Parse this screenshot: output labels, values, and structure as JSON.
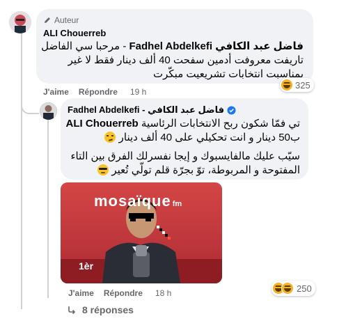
{
  "comment1": {
    "badge": "Auteur",
    "author": "ALI Chouerreb",
    "lines": [
      "فاضل عبد الكافي Fadhel Abdelkefi - مرحبا سي الفاضل",
      "تاريفت معروفت أدمين سفحت 40 ألف دينار فقط لا غير",
      "بمناسبت انتخابات تشريعيت مبكّرت"
    ],
    "mention": "فاضل عبد الكافي Fadhel Abdelkefi",
    "actions": {
      "like": "J'aime",
      "reply": "Répondre",
      "time": "19 h"
    },
    "reactions": {
      "count": "325",
      "type": "haha"
    }
  },
  "comment2": {
    "author": "Fadhel Abdelkefi - فاضل عبد الكافي",
    "verified": true,
    "mention": "ALI Chouerreb",
    "para1_line1": "تي فمّا شكون ربح الانتخابات الرئاسية",
    "para1_line2": "ب50 دينار و انت تحكيلي على 40 ألف دينار",
    "para2_line1": "سيّب عليك مالفايسبوك و إيجا نفسرلك الفرق بين التاء",
    "para2_line2": "المفتوحة و المربوطة، توّ بجرّة قلم تولّي تُعير",
    "photo": {
      "logo": "mosaïque",
      "logo_suffix": "fm",
      "corner_text": "1èr"
    },
    "actions": {
      "like": "J'aime",
      "reply": "Répondre",
      "time": "18 h"
    },
    "reactions": {
      "count": "250",
      "type": "haha"
    }
  },
  "replies_link": "8 réponses",
  "colors": {
    "bubble": "#f0f2f5",
    "secondary_text": "#65676b",
    "verified": "#1877f2",
    "haha": "#f7b125"
  }
}
